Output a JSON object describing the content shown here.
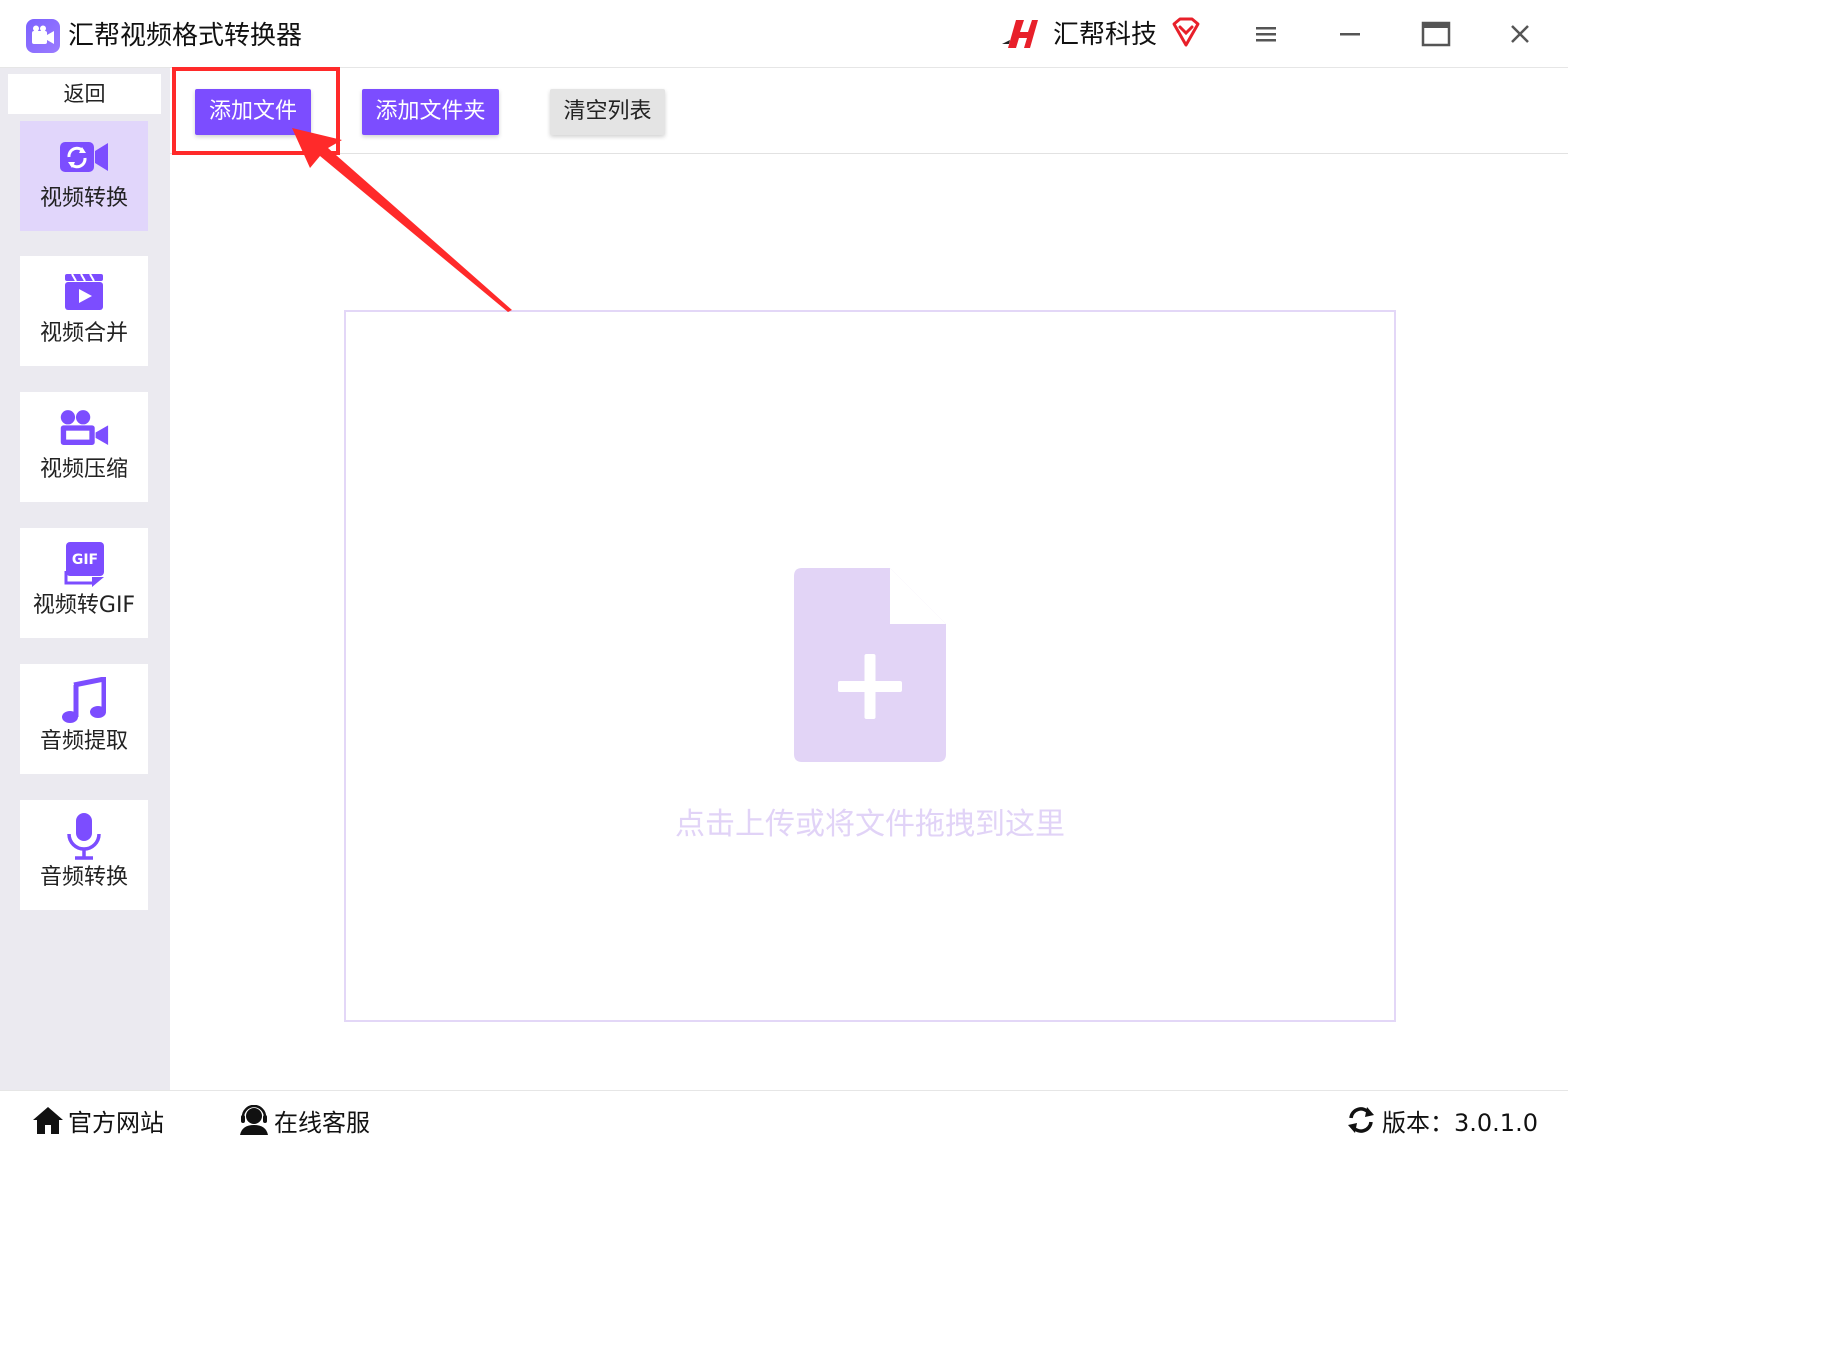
{
  "window": {
    "title": "汇帮视频格式转换器",
    "brand_name": "汇帮科技"
  },
  "colors": {
    "accent": "#7c4dff",
    "sidebar_active": "#e1d6fb",
    "dropzone_border": "#e3d7f7",
    "annotation": "#ff2a2a"
  },
  "sidebar": {
    "back_label": "返回",
    "items": [
      {
        "label": "视频转换",
        "icon": "video-convert-icon",
        "active": true
      },
      {
        "label": "视频合并",
        "icon": "video-merge-icon",
        "active": false
      },
      {
        "label": "视频压缩",
        "icon": "video-compress-icon",
        "active": false
      },
      {
        "label": "视频转GIF",
        "icon": "gif-icon",
        "active": false
      },
      {
        "label": "音频提取",
        "icon": "music-note-icon",
        "active": false
      },
      {
        "label": "音频转换",
        "icon": "microphone-icon",
        "active": false
      }
    ]
  },
  "toolbar": {
    "add_file_label": "添加文件",
    "add_folder_label": "添加文件夹",
    "clear_list_label": "清空列表"
  },
  "dropzone": {
    "hint": "点击上传或将文件拖拽到这里",
    "icon": "file-plus-icon"
  },
  "footer": {
    "official_site": "官方网站",
    "online_service": "在线客服",
    "version": "版本：3.0.1.0"
  }
}
